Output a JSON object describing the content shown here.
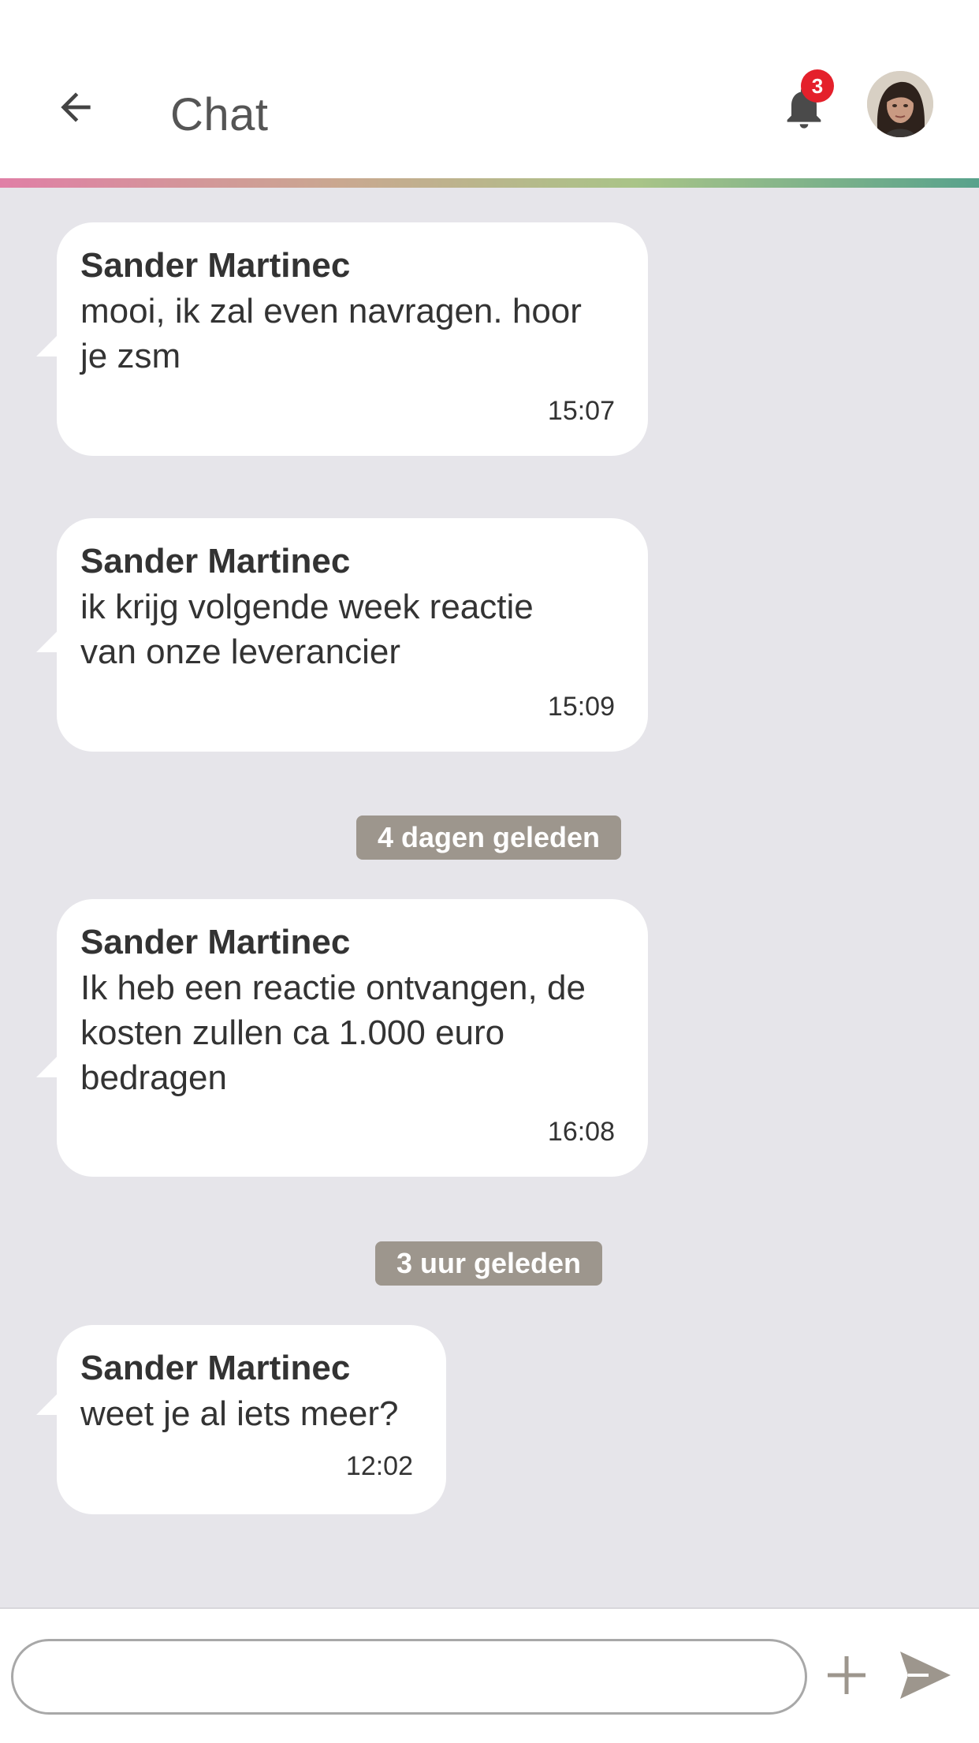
{
  "header": {
    "title": "Chat",
    "notification_count": "3",
    "icons": {
      "back": "back-arrow-icon",
      "bell": "bell-icon",
      "avatar": "user-avatar"
    }
  },
  "messages": [
    {
      "sender": "Sander Martinec",
      "lines": [
        "mooi, ik zal even navragen. hoor",
        "je zsm"
      ],
      "time": "15:07"
    },
    {
      "sender": "Sander Martinec",
      "lines": [
        "ik krijg volgende week reactie",
        "van onze leverancier"
      ],
      "time": "15:09"
    },
    {
      "sender": "Sander Martinec",
      "lines": [
        "Ik heb een reactie ontvangen, de",
        "kosten zullen ca 1.000 euro",
        "bedragen"
      ],
      "time": "16:08"
    },
    {
      "sender": "Sander Martinec",
      "lines": [
        "weet je al iets meer?"
      ],
      "time": "12:02"
    }
  ],
  "date_separators": [
    "4 dagen geleden",
    "3 uur geleden"
  ],
  "composer": {
    "input_value": "",
    "placeholder": "",
    "icons": {
      "add": "plus-icon",
      "send": "send-icon"
    }
  },
  "colors": {
    "background": "#e6e5ea",
    "bubble": "#ffffff",
    "badge": "#e4202b",
    "date_chip": "#9d968d",
    "gradient": [
      "#e07fa6",
      "#c9a890",
      "#a9c488",
      "#58a28c"
    ]
  }
}
